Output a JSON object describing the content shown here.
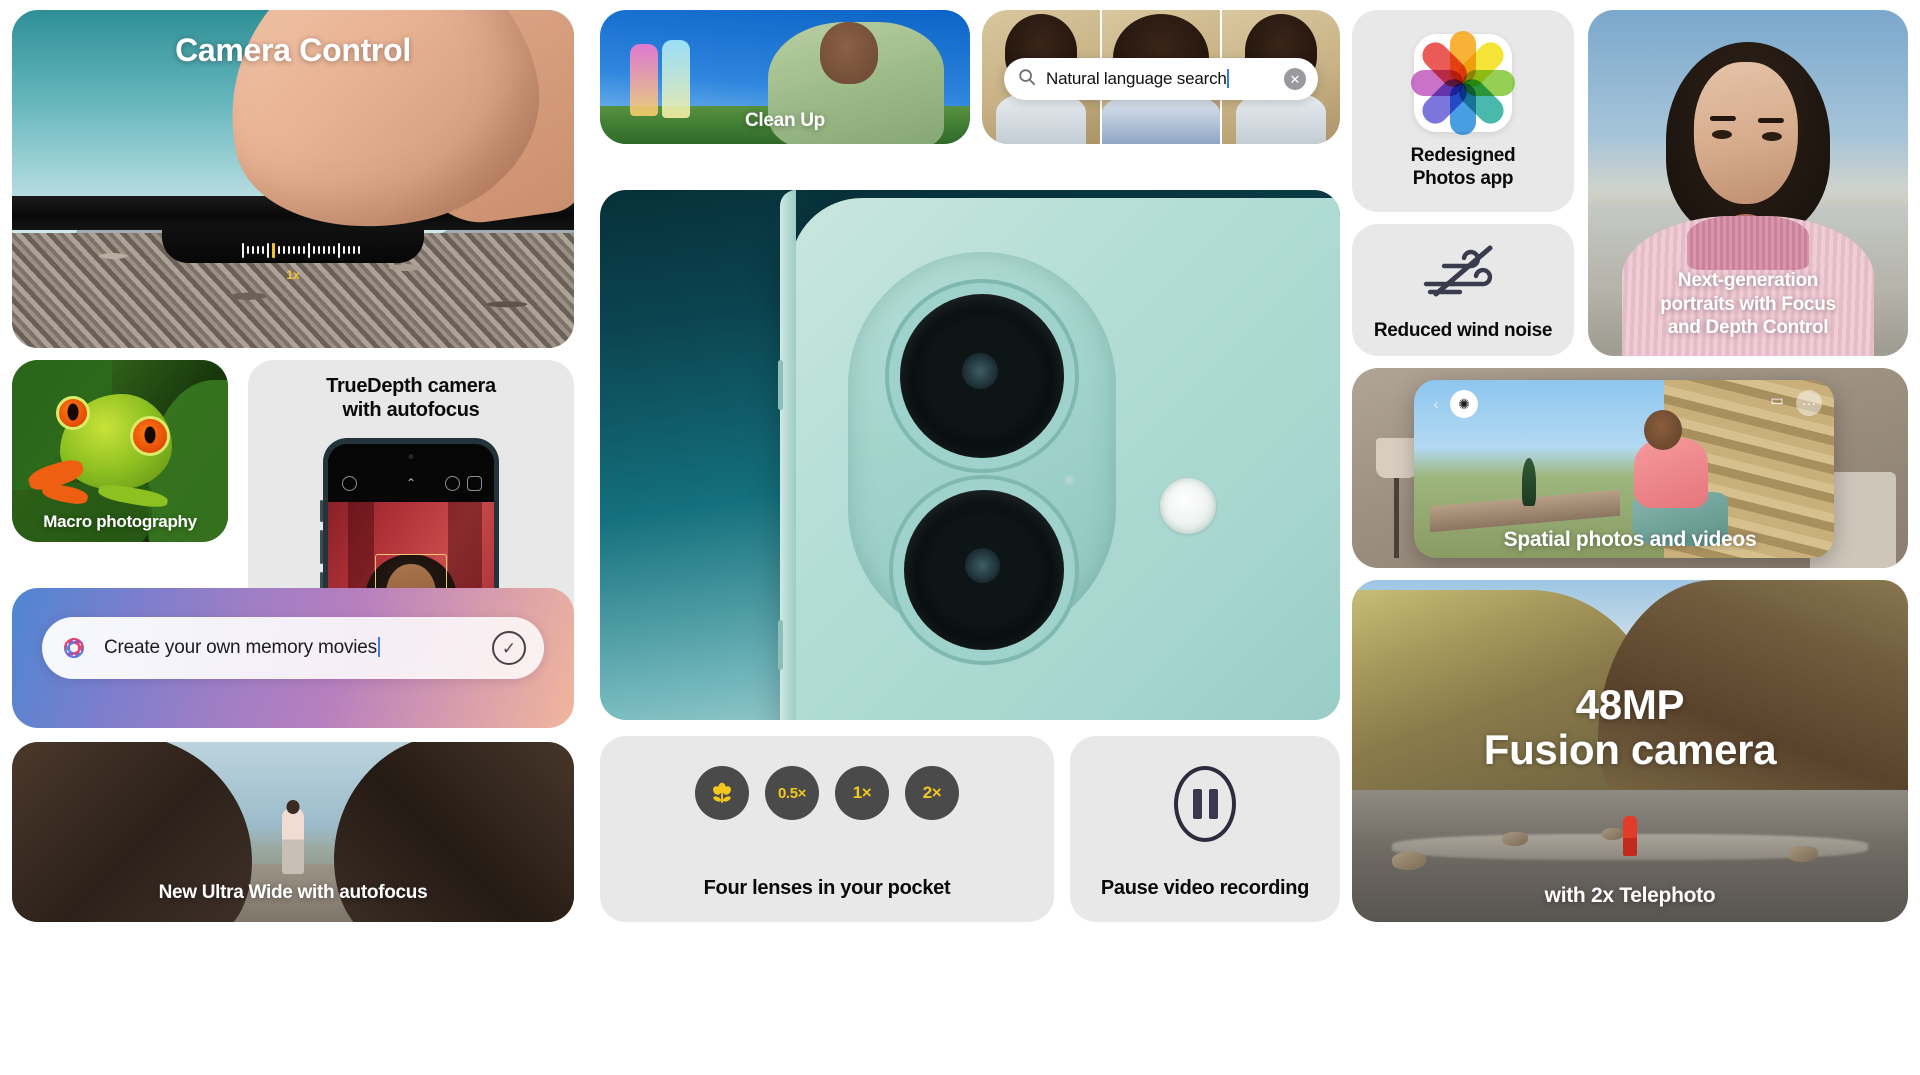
{
  "page": {
    "title": "iPhone 16 camera features grid"
  },
  "cards": {
    "camera_control": {
      "title": "Camera Control",
      "zoom_label": "1x"
    },
    "macro": {
      "caption": "Macro photography"
    },
    "truedepth": {
      "title": "TrueDepth camera\nwith autofocus",
      "line1": "TrueDepth camera",
      "line2": "with autofocus"
    },
    "memory": {
      "input_value": "Create your own memory movies",
      "placeholder": "Create your own memory movies",
      "siri_icon": "siri-glow-icon",
      "confirm_icon": "check-circle-icon"
    },
    "ultrawide": {
      "caption": "New Ultra Wide with autofocus"
    },
    "cleanup": {
      "caption": "Clean Up"
    },
    "natural_language_search": {
      "input_value": "Natural language search",
      "placeholder": "Natural language search",
      "search_icon": "search-icon",
      "clear_icon": "clear-circle-icon",
      "clear_glyph": "✕"
    },
    "hero": {
      "alt": "iPhone rear camera module in teal"
    },
    "lenses": {
      "caption": "Four lenses in your pocket",
      "items": [
        {
          "label": "❀",
          "name": "macro-lens",
          "kind": "icon"
        },
        {
          "label": "0.5×",
          "name": "lens-0-5x",
          "kind": "text"
        },
        {
          "label": "1×",
          "name": "lens-1x",
          "kind": "text"
        },
        {
          "label": "2×",
          "name": "lens-2x",
          "kind": "text"
        }
      ]
    },
    "pause": {
      "caption": "Pause video recording",
      "icon": "pause-icon"
    },
    "photos_app": {
      "line1": "Redesigned",
      "line2": "Photos app",
      "icon": "photos-app-icon"
    },
    "wind": {
      "caption": "Reduced wind noise",
      "icon": "wind-slash-icon"
    },
    "portrait": {
      "line1": "Next-generation",
      "line2": "portraits with Focus",
      "line3": "and Depth Control"
    },
    "spatial": {
      "caption": "Spatial photos and videos",
      "back_icon": "chevron-left-icon",
      "settings_icon": "spatial-settings-icon",
      "video_icon": "video-icon"
    },
    "fusion": {
      "line1": "48MP",
      "line2": "Fusion camera",
      "caption": "with 2x Telephoto"
    }
  },
  "colors": {
    "card_grey": "#e8e8e8",
    "page_bg": "#ffffff",
    "lens_yellow": "#f2c81f",
    "lens_pill": "#4a4a4a",
    "hero_teal_dark": "#073039",
    "hero_teal_light": "#bcdedc",
    "caret_blue": "#2d7df0"
  }
}
